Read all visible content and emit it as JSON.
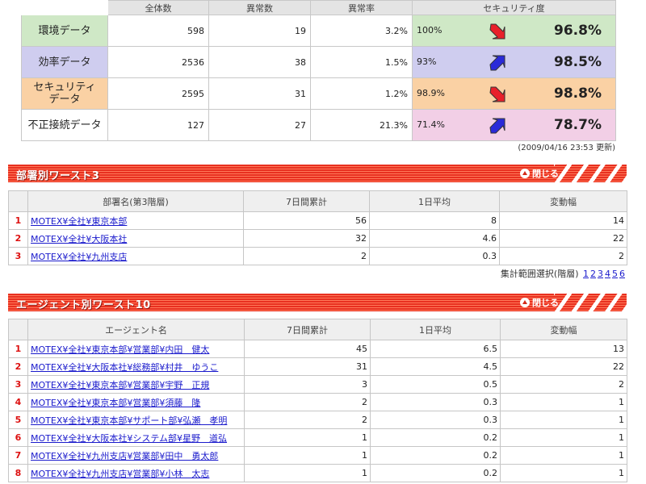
{
  "summary": {
    "headers": [
      "全体数",
      "異常数",
      "異常率",
      "セキュリティ度"
    ],
    "rows": [
      {
        "name_lines": [
          "環境データ"
        ],
        "total": "598",
        "abnormal": "19",
        "rate": "3.2%",
        "prev": "100%",
        "trend": "down",
        "security": "96.8%",
        "bg": "#cfe8c6",
        "sec_bg": "#cfe8c6"
      },
      {
        "name_lines": [
          "効率データ"
        ],
        "total": "2536",
        "abnormal": "38",
        "rate": "1.5%",
        "prev": "93%",
        "trend": "up",
        "security": "98.5%",
        "bg": "#cfcdef",
        "sec_bg": "#cfcdef"
      },
      {
        "name_lines": [
          "セキュリティ",
          "データ"
        ],
        "total": "2595",
        "abnormal": "31",
        "rate": "1.2%",
        "prev": "98.9%",
        "trend": "down",
        "security": "98.8%",
        "bg": "#fad1a4",
        "sec_bg": "#fad1a4"
      },
      {
        "name_lines": [
          "不正接続データ"
        ],
        "total": "127",
        "abnormal": "27",
        "rate": "21.3%",
        "prev": "71.4%",
        "trend": "up",
        "security": "78.7%",
        "bg": "#ffffff",
        "sec_bg": "#f2cfe6"
      }
    ],
    "updated": "(2009/04/16 23:53 更新)"
  },
  "dept": {
    "title": "部署別ワースト3",
    "close_label": "閉じる",
    "headers": [
      "",
      "部署名(第3階層)",
      "7日間累計",
      "1日平均",
      "変動幅"
    ],
    "rows": [
      {
        "rank": "1",
        "name": "MOTEX¥全社¥東京本部",
        "cumulative": "56",
        "avg": "8",
        "range": "14"
      },
      {
        "rank": "2",
        "name": "MOTEX¥全社¥大阪本社",
        "cumulative": "32",
        "avg": "4.6",
        "range": "22"
      },
      {
        "rank": "3",
        "name": "MOTEX¥全社¥九州支店",
        "cumulative": "2",
        "avg": "0.3",
        "range": "2"
      }
    ],
    "range_label": "集計範囲選択(階層)",
    "range_levels": [
      "1",
      "2",
      "3",
      "4",
      "5",
      "6"
    ]
  },
  "agent": {
    "title": "エージェント別ワースト10",
    "close_label": "閉じる",
    "headers": [
      "",
      "エージェント名",
      "7日間累計",
      "1日平均",
      "変動幅"
    ],
    "rows": [
      {
        "rank": "1",
        "name": "MOTEX¥全社¥東京本部¥営業部¥内田　健太",
        "cumulative": "45",
        "avg": "6.5",
        "range": "13"
      },
      {
        "rank": "2",
        "name": "MOTEX¥全社¥大阪本社¥総務部¥村井　ゆうこ",
        "cumulative": "31",
        "avg": "4.5",
        "range": "22"
      },
      {
        "rank": "3",
        "name": "MOTEX¥全社¥東京本部¥営業部¥宇野　正規",
        "cumulative": "3",
        "avg": "0.5",
        "range": "2"
      },
      {
        "rank": "4",
        "name": "MOTEX¥全社¥東京本部¥営業部¥須藤　隆",
        "cumulative": "2",
        "avg": "0.3",
        "range": "1"
      },
      {
        "rank": "5",
        "name": "MOTEX¥全社¥東京本部¥サポート部¥弘瀬　孝明",
        "cumulative": "2",
        "avg": "0.3",
        "range": "1"
      },
      {
        "rank": "6",
        "name": "MOTEX¥全社¥大阪本社¥システム部¥星野　道弘",
        "cumulative": "1",
        "avg": "0.2",
        "range": "1"
      },
      {
        "rank": "7",
        "name": "MOTEX¥全社¥九州支店¥営業部¥田中　勇太郎",
        "cumulative": "1",
        "avg": "0.2",
        "range": "1"
      },
      {
        "rank": "8",
        "name": "MOTEX¥全社¥九州支店¥営業部¥小林　太志",
        "cumulative": "1",
        "avg": "0.2",
        "range": "1"
      }
    ]
  },
  "colors": {
    "trend_down": "#e8202a",
    "trend_up": "#2a2ad8",
    "rank": "#dd1111",
    "link": "#1a1acc",
    "panel_bar": "#e83020"
  },
  "icons": {
    "trend_down": "trend-down-arrow-icon",
    "trend_up": "trend-up-arrow-icon",
    "close": "close-circle-icon"
  }
}
